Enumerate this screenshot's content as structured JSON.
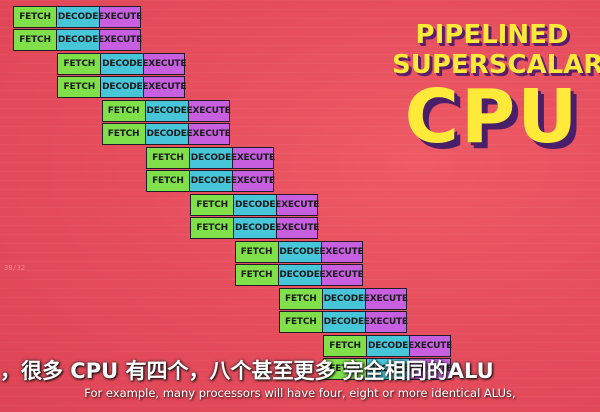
{
  "stages": {
    "fetch": "FETCH",
    "decode": "DECODE",
    "execute": "EXECUTE"
  },
  "colors": {
    "fetch": "#7fe04a",
    "decode": "#46c6d8",
    "execute": "#c85ee0",
    "title": "#ffea3a"
  },
  "pipeline_pairs": 8,
  "title": {
    "line1": "PIPELINED",
    "line2": "SUPERSCALAR",
    "line3": "CPU"
  },
  "timestamp": "38/32",
  "subtitles": {
    "chinese": "，很多 CPU 有四个，八个甚至更多 完全相同的ALU",
    "english": "For example, many processors will have four, eight or more identical ALUs,"
  }
}
